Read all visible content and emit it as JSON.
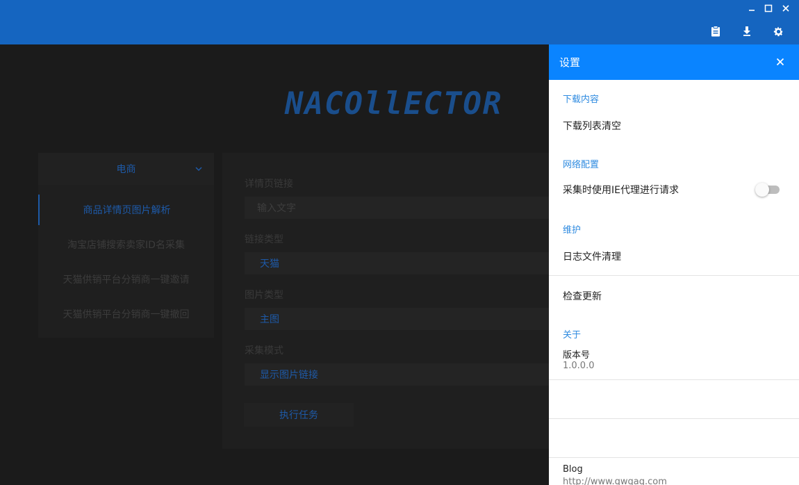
{
  "window": {
    "controls": {
      "minimize_icon": "minimize-icon",
      "maximize_icon": "maximize-icon",
      "close_icon": "close-icon"
    },
    "toolbar": [
      "clipboard-icon",
      "download-icon",
      "gear-icon"
    ],
    "colors": {
      "titlebar": "#1565c0",
      "panel_header": "#0a84ff",
      "accent": "#2f8be0"
    }
  },
  "logo": {
    "text": "NACOllECTOR"
  },
  "nav": {
    "category": "电商",
    "items": [
      {
        "label": "商品详情页图片解析",
        "active": true
      },
      {
        "label": "淘宝店铺搜索卖家ID名采集",
        "active": false
      },
      {
        "label": "天猫供销平台分销商一键邀请",
        "active": false
      },
      {
        "label": "天猫供销平台分销商一键撤回",
        "active": false
      }
    ]
  },
  "form": {
    "link_label": "详情页链接",
    "link_placeholder": "输入文字",
    "link_type_label": "链接类型",
    "link_type_value": "天猫",
    "image_type_label": "图片类型",
    "image_type_value": "主图",
    "mode_label": "采集模式",
    "mode_value": "显示图片链接",
    "run_button": "执行任务"
  },
  "settings": {
    "title": "设置",
    "download_section": "下载内容",
    "clear_download_list": "下载列表清空",
    "network_section": "网络配置",
    "ie_proxy_label": "采集时使用IE代理进行请求",
    "ie_proxy_enabled": false,
    "maintenance_section": "维护",
    "clear_logs": "日志文件清理",
    "check_update": "检查更新",
    "about_section": "关于",
    "version_label": "版本号",
    "version_value": "1.0.0.0",
    "blog_label": "Blog",
    "blog_url": "http://www.qwqaq.com"
  }
}
